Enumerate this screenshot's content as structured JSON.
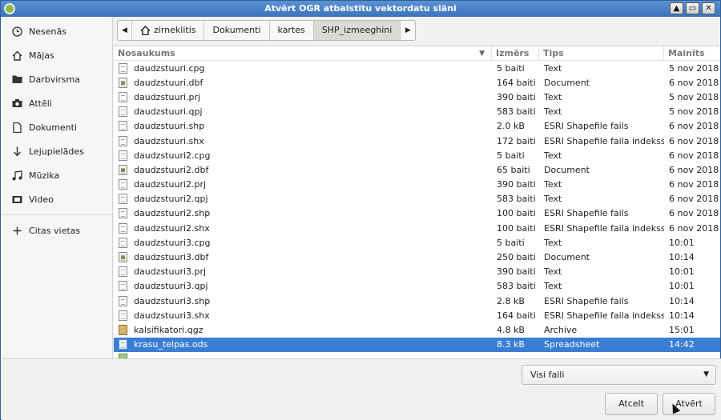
{
  "window": {
    "title": "Atvērt OGR atbalstītu vektordatu slāni"
  },
  "titlebar_buttons": [
    "▲",
    "▭",
    "✕"
  ],
  "sidebar": {
    "items": [
      {
        "label": "Nesenās",
        "icon": "clock-icon"
      },
      {
        "label": "Mājas",
        "icon": "home-icon"
      },
      {
        "label": "Darbvirsma",
        "icon": "folder-icon"
      },
      {
        "label": "Attēli",
        "icon": "camera-icon"
      },
      {
        "label": "Dokumenti",
        "icon": "document-icon"
      },
      {
        "label": "Lejupielādes",
        "icon": "arrow-down-icon"
      },
      {
        "label": "Mūzika",
        "icon": "music-icon"
      },
      {
        "label": "Video",
        "icon": "video-icon"
      }
    ],
    "other_locations": {
      "label": "Citas vietas",
      "icon": "plus-icon"
    }
  },
  "pathbar": {
    "segments": [
      "zirneklitis",
      "Dokumenti",
      "kartes",
      "SHP_izmeeghini"
    ]
  },
  "filelist": {
    "columns": {
      "name": "Nosaukums",
      "size": "Izmērs",
      "type": "Tips",
      "modified": "Mainīts"
    },
    "rows": [
      {
        "name": "daudzstuuri.cpg",
        "size": "5 baiti",
        "type": "Text",
        "modified": "5 nov 2018",
        "icon": "text"
      },
      {
        "name": "daudzstuuri.dbf",
        "size": "164 baiti",
        "type": "Document",
        "modified": "6 nov 2018",
        "icon": "doc"
      },
      {
        "name": "daudzstuuri.prj",
        "size": "390 baiti",
        "type": "Text",
        "modified": "5 nov 2018",
        "icon": "text"
      },
      {
        "name": "daudzstuuri.qpj",
        "size": "583 baiti",
        "type": "Text",
        "modified": "5 nov 2018",
        "icon": "text"
      },
      {
        "name": "daudzstuuri.shp",
        "size": "2.0 kB",
        "type": "ESRI Shapefile fails",
        "modified": "6 nov 2018",
        "icon": "text"
      },
      {
        "name": "daudzstuuri.shx",
        "size": "172 baiti",
        "type": "ESRI Shapefile faila indekss",
        "modified": "6 nov 2018",
        "icon": "text"
      },
      {
        "name": "daudzstuuri2.cpg",
        "size": "5 baiti",
        "type": "Text",
        "modified": "6 nov 2018",
        "icon": "text"
      },
      {
        "name": "daudzstuuri2.dbf",
        "size": "65 baiti",
        "type": "Document",
        "modified": "6 nov 2018",
        "icon": "doc"
      },
      {
        "name": "daudzstuuri2.prj",
        "size": "390 baiti",
        "type": "Text",
        "modified": "6 nov 2018",
        "icon": "text"
      },
      {
        "name": "daudzstuuri2.qpj",
        "size": "583 baiti",
        "type": "Text",
        "modified": "6 nov 2018",
        "icon": "text"
      },
      {
        "name": "daudzstuuri2.shp",
        "size": "100 baiti",
        "type": "ESRI Shapefile fails",
        "modified": "6 nov 2018",
        "icon": "text"
      },
      {
        "name": "daudzstuuri2.shx",
        "size": "100 baiti",
        "type": "ESRI Shapefile faila indekss",
        "modified": "6 nov 2018",
        "icon": "text"
      },
      {
        "name": "daudzstuuri3.cpg",
        "size": "5 baiti",
        "type": "Text",
        "modified": "10:01",
        "icon": "text"
      },
      {
        "name": "daudzstuuri3.dbf",
        "size": "250 baiti",
        "type": "Document",
        "modified": "10:14",
        "icon": "doc"
      },
      {
        "name": "daudzstuuri3.prj",
        "size": "390 baiti",
        "type": "Text",
        "modified": "10:01",
        "icon": "text"
      },
      {
        "name": "daudzstuuri3.qpj",
        "size": "583 baiti",
        "type": "Text",
        "modified": "10:01",
        "icon": "text"
      },
      {
        "name": "daudzstuuri3.shp",
        "size": "2.8 kB",
        "type": "ESRI Shapefile fails",
        "modified": "10:14",
        "icon": "text"
      },
      {
        "name": "daudzstuuri3.shx",
        "size": "164 baiti",
        "type": "ESRI Shapefile faila indekss",
        "modified": "10:14",
        "icon": "text"
      },
      {
        "name": "kalsifikatori.qgz",
        "size": "4.8 kB",
        "type": "Archive",
        "modified": "15:01",
        "icon": "archive"
      },
      {
        "name": "krasu_telpas.ods",
        "size": "8.3 kB",
        "type": "Spreadsheet",
        "modified": "14:42",
        "icon": "sheet",
        "selected": true
      },
      {
        "name": "",
        "size": "",
        "type": "",
        "modified": "",
        "icon": "green"
      }
    ]
  },
  "filter": {
    "value": "Visi faili"
  },
  "buttons": {
    "cancel": "Atcelt",
    "open": "Atvērt"
  },
  "colors": {
    "selection": "#3a7ed4",
    "titlebar": "#3a73bd"
  }
}
